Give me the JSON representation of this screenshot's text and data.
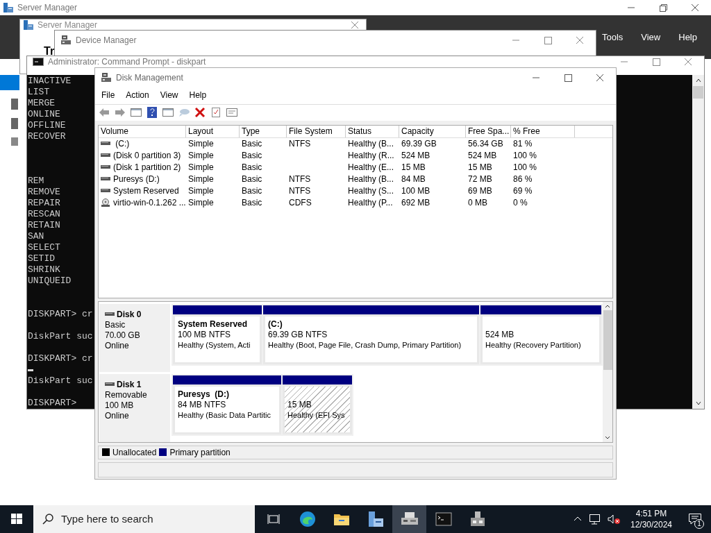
{
  "server_manager": {
    "title": "Server Manager",
    "menu": [
      "Tools",
      "View",
      "Help"
    ]
  },
  "server_manager_2": {
    "title": "Server Manager",
    "heading": "Tr"
  },
  "device_manager": {
    "title": "Device Manager"
  },
  "command_prompt": {
    "title": "Administrator: Command Prompt - diskpart",
    "lines": [
      {
        "kind": "text",
        "text": "INACTIVE"
      },
      {
        "kind": "text",
        "text": "LIST"
      },
      {
        "kind": "text",
        "text": "MERGE"
      },
      {
        "kind": "text",
        "text": "ONLINE"
      },
      {
        "kind": "text",
        "text": "OFFLINE"
      },
      {
        "kind": "text",
        "text": "RECOVER"
      },
      {
        "kind": "blank"
      },
      {
        "kind": "blank"
      },
      {
        "kind": "blank"
      },
      {
        "kind": "text",
        "text": "REM"
      },
      {
        "kind": "text",
        "text": "REMOVE"
      },
      {
        "kind": "text",
        "text": "REPAIR"
      },
      {
        "kind": "text",
        "text": "RESCAN"
      },
      {
        "kind": "text",
        "text": "RETAIN"
      },
      {
        "kind": "text",
        "text": "SAN"
      },
      {
        "kind": "text",
        "text": "SELECT"
      },
      {
        "kind": "text",
        "text": "SETID"
      },
      {
        "kind": "text",
        "text": "SHRINK"
      },
      {
        "kind": "text",
        "text": "UNIQUEID"
      },
      {
        "kind": "blank"
      },
      {
        "kind": "blank"
      },
      {
        "kind": "text",
        "text": "DISKPART> cr"
      },
      {
        "kind": "blank"
      },
      {
        "kind": "text",
        "text": "DiskPart suc"
      },
      {
        "kind": "blank"
      },
      {
        "kind": "text",
        "text": "DISKPART> cr"
      },
      {
        "kind": "cursor"
      },
      {
        "kind": "text",
        "text": "DiskPart suc"
      },
      {
        "kind": "blank"
      },
      {
        "kind": "text",
        "text": "DISKPART>"
      }
    ]
  },
  "disk_management": {
    "title": "Disk Management",
    "menu": [
      "File",
      "Action",
      "View",
      "Help"
    ],
    "table": {
      "columns": [
        "Volume",
        "Layout",
        "Type",
        "File System",
        "Status",
        "Capacity",
        "Free Spa...",
        "% Free"
      ],
      "rows": [
        {
          "kind": "disk",
          "cells": [
            " (C:)",
            "Simple",
            "Basic",
            "NTFS",
            "Healthy (B...",
            "69.39 GB",
            "56.34 GB",
            "81 %"
          ]
        },
        {
          "kind": "disk",
          "cells": [
            "(Disk 0 partition 3)",
            "Simple",
            "Basic",
            "",
            "Healthy (R...",
            "524 MB",
            "524 MB",
            "100 %"
          ]
        },
        {
          "kind": "disk",
          "cells": [
            "(Disk 1 partition 2)",
            "Simple",
            "Basic",
            "",
            "Healthy (E...",
            "15 MB",
            "15 MB",
            "100 %"
          ]
        },
        {
          "kind": "disk",
          "cells": [
            "Puresys (D:)",
            "Simple",
            "Basic",
            "NTFS",
            "Healthy (B...",
            "84 MB",
            "72 MB",
            "86 %"
          ]
        },
        {
          "kind": "disk",
          "cells": [
            "System Reserved",
            "Simple",
            "Basic",
            "NTFS",
            "Healthy (S...",
            "100 MB",
            "69 MB",
            "69 %"
          ]
        },
        {
          "kind": "cd",
          "cells": [
            "virtio-win-0.1.262 ...",
            "Simple",
            "Basic",
            "CDFS",
            "Healthy (P...",
            "692 MB",
            "0 MB",
            "0 %"
          ]
        }
      ]
    },
    "disks": [
      {
        "name": "Disk 0",
        "type": "Basic",
        "size": "70.00 GB",
        "status": "Online",
        "partitions": [
          {
            "title": "System Reserved",
            "size": "100 MB NTFS",
            "status": "Healthy (System, Acti",
            "hatched": false
          },
          {
            "title": "(C:)",
            "size": "69.39 GB NTFS",
            "status": "Healthy (Boot, Page File, Crash Dump, Primary Partition)",
            "hatched": false
          },
          {
            "size": "524 MB",
            "status": "Healthy (Recovery Partition)",
            "hatched": false
          }
        ]
      },
      {
        "name": "Disk 1",
        "type": "Removable",
        "size": "100 MB",
        "status": "Online",
        "partitions": [
          {
            "title": "Puresys  (D:)",
            "size": "84 MB NTFS",
            "status": "Healthy (Basic Data Partitic",
            "hatched": false
          },
          {
            "size": "15 MB",
            "status": "Healthy (EFI Sys",
            "hatched": true
          }
        ]
      }
    ],
    "legend": [
      {
        "label": "Unallocated",
        "color": "#000000"
      },
      {
        "label": "Primary partition",
        "color": "#000080"
      }
    ]
  },
  "taskbar": {
    "search_placeholder": "Type here to search",
    "apps": [
      {
        "kind": "task-view",
        "selected": false
      },
      {
        "kind": "edge",
        "selected": false
      },
      {
        "kind": "folder",
        "selected": false
      },
      {
        "kind": "server",
        "selected": false
      },
      {
        "kind": "disk",
        "selected": true
      },
      {
        "kind": "console",
        "selected": false
      },
      {
        "kind": "device",
        "selected": false
      }
    ],
    "time": "4:51 PM",
    "date": "12/30/2024",
    "notifications": "1"
  }
}
